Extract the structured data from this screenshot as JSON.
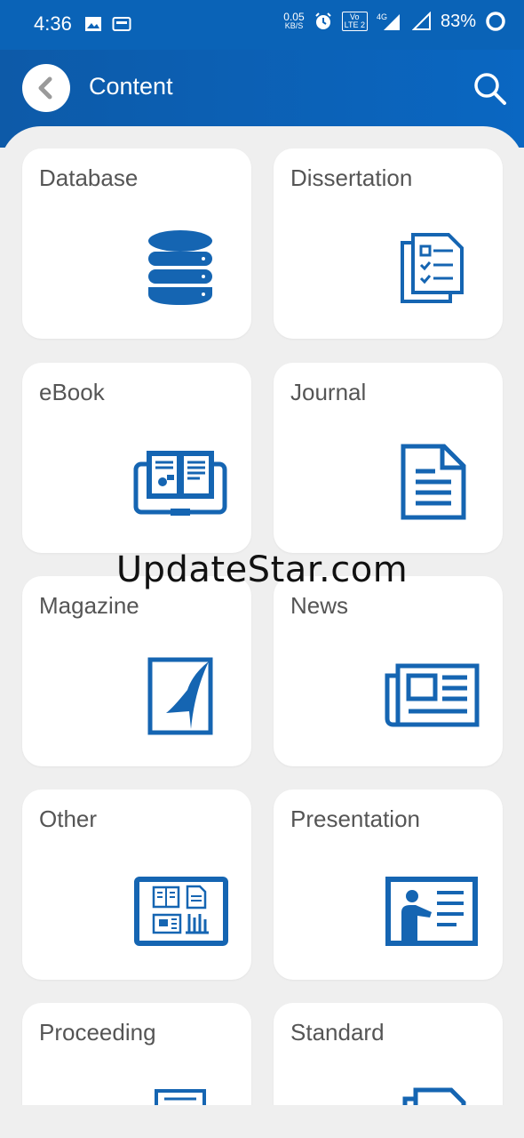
{
  "status_bar": {
    "time": "4:36",
    "network_speed_top": "0.05",
    "network_speed_bottom": "KB/S",
    "volte": "Vo",
    "lte": "LTE 2",
    "signal_type": "4G",
    "battery": "83%"
  },
  "app_bar": {
    "title": "Content",
    "back_icon": "back-arrow-icon",
    "search_icon": "search-icon"
  },
  "categories": [
    {
      "label": "Database",
      "icon": "database-icon"
    },
    {
      "label": "Dissertation",
      "icon": "dissertation-icon"
    },
    {
      "label": "eBook",
      "icon": "ebook-icon"
    },
    {
      "label": "Journal",
      "icon": "journal-icon"
    },
    {
      "label": "Magazine",
      "icon": "magazine-icon"
    },
    {
      "label": "News",
      "icon": "newspaper-icon"
    },
    {
      "label": "Other",
      "icon": "other-icon"
    },
    {
      "label": "Presentation",
      "icon": "presentation-icon"
    },
    {
      "label": "Proceeding",
      "icon": "proceeding-icon"
    },
    {
      "label": "Standard",
      "icon": "standard-icon"
    }
  ],
  "watermark": "UpdateStar.com",
  "colors": {
    "primary": "#0a63b7",
    "icon": "#1565b2",
    "label": "#555555",
    "background": "#efefef"
  }
}
